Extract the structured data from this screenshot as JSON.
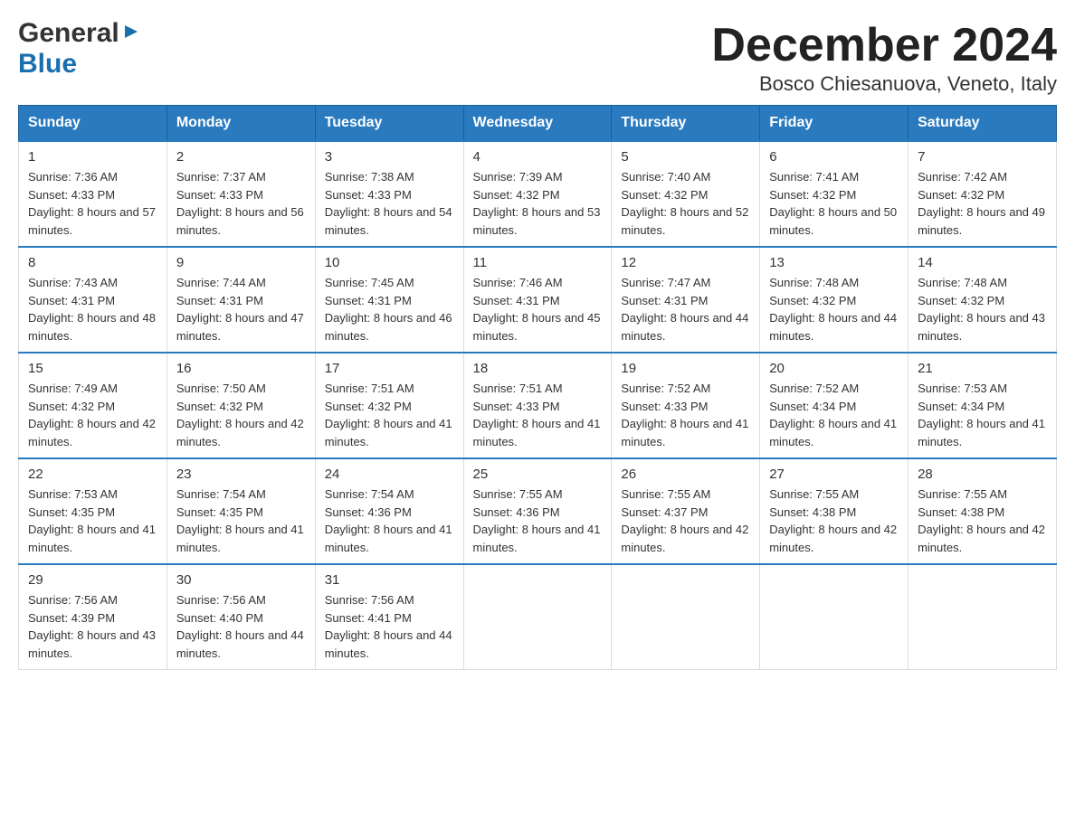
{
  "header": {
    "title": "December 2024",
    "subtitle": "Bosco Chiesanuova, Veneto, Italy"
  },
  "logo": {
    "general": "General",
    "blue": "Blue"
  },
  "days_of_week": [
    "Sunday",
    "Monday",
    "Tuesday",
    "Wednesday",
    "Thursday",
    "Friday",
    "Saturday"
  ],
  "weeks": [
    [
      {
        "day": "1",
        "sunrise": "7:36 AM",
        "sunset": "4:33 PM",
        "daylight": "8 hours and 57 minutes."
      },
      {
        "day": "2",
        "sunrise": "7:37 AM",
        "sunset": "4:33 PM",
        "daylight": "8 hours and 56 minutes."
      },
      {
        "day": "3",
        "sunrise": "7:38 AM",
        "sunset": "4:33 PM",
        "daylight": "8 hours and 54 minutes."
      },
      {
        "day": "4",
        "sunrise": "7:39 AM",
        "sunset": "4:32 PM",
        "daylight": "8 hours and 53 minutes."
      },
      {
        "day": "5",
        "sunrise": "7:40 AM",
        "sunset": "4:32 PM",
        "daylight": "8 hours and 52 minutes."
      },
      {
        "day": "6",
        "sunrise": "7:41 AM",
        "sunset": "4:32 PM",
        "daylight": "8 hours and 50 minutes."
      },
      {
        "day": "7",
        "sunrise": "7:42 AM",
        "sunset": "4:32 PM",
        "daylight": "8 hours and 49 minutes."
      }
    ],
    [
      {
        "day": "8",
        "sunrise": "7:43 AM",
        "sunset": "4:31 PM",
        "daylight": "8 hours and 48 minutes."
      },
      {
        "day": "9",
        "sunrise": "7:44 AM",
        "sunset": "4:31 PM",
        "daylight": "8 hours and 47 minutes."
      },
      {
        "day": "10",
        "sunrise": "7:45 AM",
        "sunset": "4:31 PM",
        "daylight": "8 hours and 46 minutes."
      },
      {
        "day": "11",
        "sunrise": "7:46 AM",
        "sunset": "4:31 PM",
        "daylight": "8 hours and 45 minutes."
      },
      {
        "day": "12",
        "sunrise": "7:47 AM",
        "sunset": "4:31 PM",
        "daylight": "8 hours and 44 minutes."
      },
      {
        "day": "13",
        "sunrise": "7:48 AM",
        "sunset": "4:32 PM",
        "daylight": "8 hours and 44 minutes."
      },
      {
        "day": "14",
        "sunrise": "7:48 AM",
        "sunset": "4:32 PM",
        "daylight": "8 hours and 43 minutes."
      }
    ],
    [
      {
        "day": "15",
        "sunrise": "7:49 AM",
        "sunset": "4:32 PM",
        "daylight": "8 hours and 42 minutes."
      },
      {
        "day": "16",
        "sunrise": "7:50 AM",
        "sunset": "4:32 PM",
        "daylight": "8 hours and 42 minutes."
      },
      {
        "day": "17",
        "sunrise": "7:51 AM",
        "sunset": "4:32 PM",
        "daylight": "8 hours and 41 minutes."
      },
      {
        "day": "18",
        "sunrise": "7:51 AM",
        "sunset": "4:33 PM",
        "daylight": "8 hours and 41 minutes."
      },
      {
        "day": "19",
        "sunrise": "7:52 AM",
        "sunset": "4:33 PM",
        "daylight": "8 hours and 41 minutes."
      },
      {
        "day": "20",
        "sunrise": "7:52 AM",
        "sunset": "4:34 PM",
        "daylight": "8 hours and 41 minutes."
      },
      {
        "day": "21",
        "sunrise": "7:53 AM",
        "sunset": "4:34 PM",
        "daylight": "8 hours and 41 minutes."
      }
    ],
    [
      {
        "day": "22",
        "sunrise": "7:53 AM",
        "sunset": "4:35 PM",
        "daylight": "8 hours and 41 minutes."
      },
      {
        "day": "23",
        "sunrise": "7:54 AM",
        "sunset": "4:35 PM",
        "daylight": "8 hours and 41 minutes."
      },
      {
        "day": "24",
        "sunrise": "7:54 AM",
        "sunset": "4:36 PM",
        "daylight": "8 hours and 41 minutes."
      },
      {
        "day": "25",
        "sunrise": "7:55 AM",
        "sunset": "4:36 PM",
        "daylight": "8 hours and 41 minutes."
      },
      {
        "day": "26",
        "sunrise": "7:55 AM",
        "sunset": "4:37 PM",
        "daylight": "8 hours and 42 minutes."
      },
      {
        "day": "27",
        "sunrise": "7:55 AM",
        "sunset": "4:38 PM",
        "daylight": "8 hours and 42 minutes."
      },
      {
        "day": "28",
        "sunrise": "7:55 AM",
        "sunset": "4:38 PM",
        "daylight": "8 hours and 42 minutes."
      }
    ],
    [
      {
        "day": "29",
        "sunrise": "7:56 AM",
        "sunset": "4:39 PM",
        "daylight": "8 hours and 43 minutes."
      },
      {
        "day": "30",
        "sunrise": "7:56 AM",
        "sunset": "4:40 PM",
        "daylight": "8 hours and 44 minutes."
      },
      {
        "day": "31",
        "sunrise": "7:56 AM",
        "sunset": "4:41 PM",
        "daylight": "8 hours and 44 minutes."
      },
      null,
      null,
      null,
      null
    ]
  ],
  "labels": {
    "sunrise": "Sunrise: ",
    "sunset": "Sunset: ",
    "daylight": "Daylight: "
  }
}
